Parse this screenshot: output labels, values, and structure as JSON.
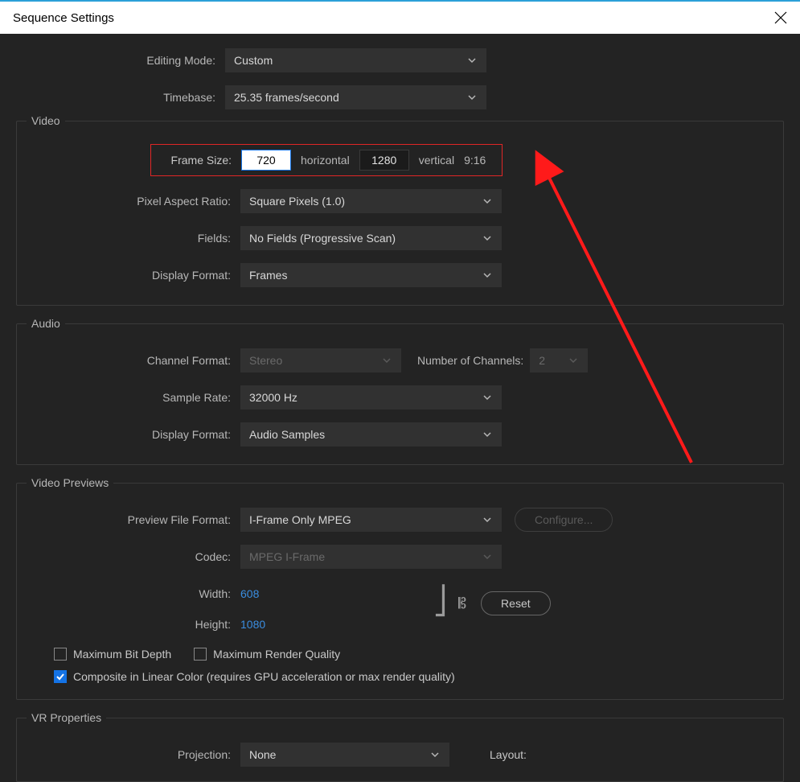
{
  "window": {
    "title": "Sequence Settings"
  },
  "top": {
    "editing_mode_label": "Editing Mode:",
    "editing_mode_value": "Custom",
    "timebase_label": "Timebase:",
    "timebase_value": "25.35  frames/second"
  },
  "video": {
    "section_title": "Video",
    "frame_size_label": "Frame Size:",
    "frame_width": "720",
    "horizontal_label": "horizontal",
    "frame_height": "1280",
    "vertical_label": "vertical",
    "aspect_text": "9:16",
    "par_label": "Pixel Aspect Ratio:",
    "par_value": "Square Pixels (1.0)",
    "fields_label": "Fields:",
    "fields_value": "No Fields (Progressive Scan)",
    "display_format_label": "Display Format:",
    "display_format_value": "Frames"
  },
  "audio": {
    "section_title": "Audio",
    "channel_format_label": "Channel Format:",
    "channel_format_value": "Stereo",
    "num_channels_label": "Number of Channels:",
    "num_channels_value": "2",
    "sample_rate_label": "Sample Rate:",
    "sample_rate_value": "32000 Hz",
    "display_format_label": "Display Format:",
    "display_format_value": "Audio Samples"
  },
  "previews": {
    "section_title": "Video Previews",
    "file_format_label": "Preview File Format:",
    "file_format_value": "I-Frame Only MPEG",
    "configure_label": "Configure...",
    "codec_label": "Codec:",
    "codec_value": "MPEG I-Frame",
    "width_label": "Width:",
    "width_value": "608",
    "height_label": "Height:",
    "height_value": "1080",
    "reset_label": "Reset",
    "max_bit_depth_label": "Maximum Bit Depth",
    "max_render_quality_label": "Maximum Render Quality",
    "composite_label": "Composite in Linear Color (requires GPU acceleration or max render quality)"
  },
  "vr": {
    "section_title": "VR Properties",
    "projection_label": "Projection:",
    "projection_value": "None",
    "layout_label": "Layout:"
  }
}
